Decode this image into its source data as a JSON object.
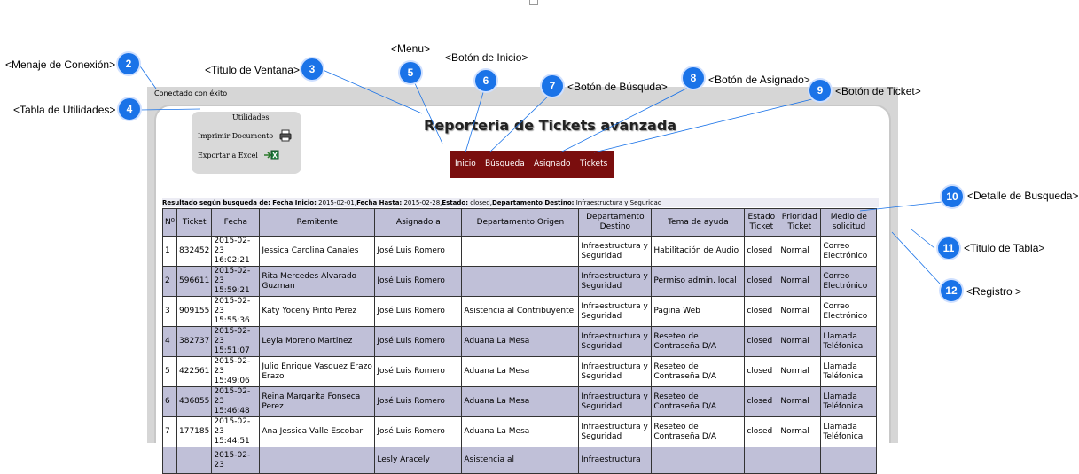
{
  "annotations": [
    {
      "num": "2",
      "label": "<Menaje de Conexión>"
    },
    {
      "num": "3",
      "label": "<Titulo de Ventana>"
    },
    {
      "num": "4",
      "label": "<Tabla de Utilidades>"
    },
    {
      "num": "5",
      "label": "<Menu>"
    },
    {
      "num": "6",
      "label": "<Botón de Inicio>"
    },
    {
      "num": "7",
      "label": "<Botón de Búsquda>"
    },
    {
      "num": "8",
      "label": "<Botón de Asignado>"
    },
    {
      "num": "9",
      "label": "<Botón de Ticket>"
    },
    {
      "num": "10",
      "label": "<Detalle de Busqueda>"
    },
    {
      "num": "11",
      "label": "<Titulo de Tabla>"
    },
    {
      "num": "12",
      "label": "<Registro >"
    }
  ],
  "connection_message": "Conectado con éxito",
  "utilities": {
    "title": "Utilidades",
    "print_label": "Imprimir Documento",
    "export_label": "Exportar a Excel",
    "print_icon": "printer-icon",
    "export_icon": "excel-icon"
  },
  "page_title": "Reporteria de Tickets avanzada",
  "menu": {
    "inicio": "Inicio",
    "busqueda": "Búsqueda",
    "asignado": "Asignado",
    "tickets": "Tickets",
    "color": "#7a0e0e"
  },
  "search_detail": {
    "prefix": "Resultado según busqueda de:",
    "fecha_inicio_label": "Fecha Inicio:",
    "fecha_inicio": "2015-02-01",
    "fecha_hasta_label": "Fecha Hasta:",
    "fecha_hasta": "2015-02-28",
    "estado_label": "Estado:",
    "estado": "closed",
    "depto_label": "Departamento Destino:",
    "depto": "Infraestructura y Seguridad"
  },
  "table": {
    "headers": [
      "Nº",
      "Ticket",
      "Fecha",
      "Remitente",
      "Asignado a",
      "Departamento Origen",
      "Departamento Destino",
      "Tema de ayuda",
      "Estado Ticket",
      "Prioridad Ticket",
      "Medio de solicitud"
    ],
    "rows": [
      [
        "1",
        "832452",
        "2015-02-23 16:02:21",
        "Jessica Carolina Canales",
        "José Luis Romero",
        "",
        "Infraestructura y Seguridad",
        "Habilitación de Audio",
        "closed",
        "Normal",
        "Correo Electrónico"
      ],
      [
        "2",
        "596611",
        "2015-02-23 15:59:21",
        "Rita Mercedes Alvarado Guzman",
        "José Luis Romero",
        "",
        "Infraestructura y Seguridad",
        "Permiso admin. local",
        "closed",
        "Normal",
        "Correo Electrónico"
      ],
      [
        "3",
        "909155",
        "2015-02-23 15:55:36",
        "Katy Yoceny Pinto Perez",
        "José Luis Romero",
        "Asistencia al Contribuyente",
        "Infraestructura y Seguridad",
        "Pagina Web",
        "closed",
        "Normal",
        "Correo Electrónico"
      ],
      [
        "4",
        "382737",
        "2015-02-23 15:51:07",
        "Leyla Moreno Martinez",
        "José Luis Romero",
        "Aduana La Mesa",
        "Infraestructura y Seguridad",
        "Reseteo de Contraseña D/A",
        "closed",
        "Normal",
        "Llamada Teléfonica"
      ],
      [
        "5",
        "422561",
        "2015-02-23 15:49:06",
        "Julio Enrique Vasquez Erazo Erazo",
        "José Luis Romero",
        "Aduana La Mesa",
        "Infraestructura y Seguridad",
        "Reseteo de Contraseña D/A",
        "closed",
        "Normal",
        "Llamada Teléfonica"
      ],
      [
        "6",
        "436855",
        "2015-02-23 15:46:48",
        "Reina Margarita Fonseca Perez",
        "José Luis Romero",
        "Aduana La Mesa",
        "Infraestructura y Seguridad",
        "Reseteo de Contraseña D/A",
        "closed",
        "Normal",
        "Llamada Teléfonica"
      ],
      [
        "7",
        "177185",
        "2015-02-23 15:44:51",
        "Ana Jessica Valle Escobar",
        "José Luis Romero",
        "Aduana La Mesa",
        "Infraestructura y Seguridad",
        "Reseteo de Contraseña D/A",
        "closed",
        "Normal",
        "Llamada Teléfonica"
      ],
      [
        "",
        "",
        "2015-02-23",
        "",
        "Lesly Aracely",
        "Asistencia al",
        "Infraestructura",
        "",
        "",
        "",
        ""
      ]
    ]
  },
  "colors": {
    "badge": "#1a73e8",
    "row_alt": "#c0c0d8",
    "menu_bg": "#7a0e0e"
  }
}
